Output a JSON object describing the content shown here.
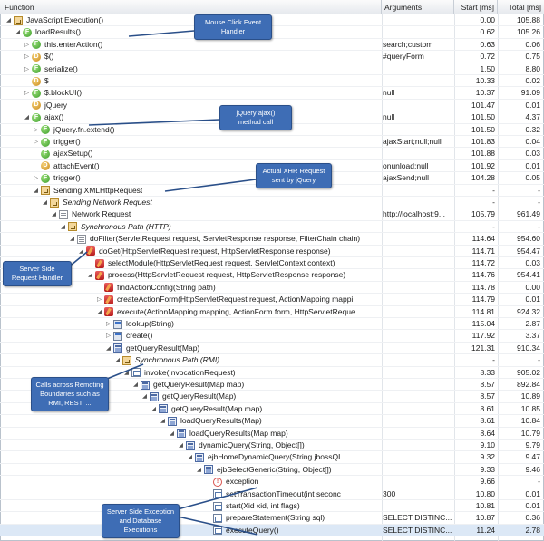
{
  "header": {
    "function_col": "Function",
    "arguments_col": "Arguments",
    "start_col": "Start [ms]",
    "total_col": "Total [ms]"
  },
  "rows": [
    {
      "d": 0,
      "tw": "◢",
      "ic": "r",
      "fn": "JavaScript Execution()",
      "args": "",
      "start": "0.00",
      "total": "105.88"
    },
    {
      "d": 1,
      "tw": "◢",
      "ic": "f",
      "fn": "loadResults()",
      "args": "",
      "start": "0.62",
      "total": "105.26"
    },
    {
      "d": 2,
      "tw": "▷",
      "ic": "f",
      "fn": "this.enterAction()",
      "args": "search;custom",
      "start": "0.63",
      "total": "0.06"
    },
    {
      "d": 2,
      "tw": "▷",
      "ic": "d",
      "fn": "$()",
      "args": "#queryForm",
      "start": "0.72",
      "total": "0.75"
    },
    {
      "d": 2,
      "tw": "▷",
      "ic": "f",
      "fn": "serialize()",
      "args": "",
      "start": "1.50",
      "total": "8.80"
    },
    {
      "d": 2,
      "tw": "",
      "ic": "d",
      "fn": "$",
      "args": "",
      "start": "10.33",
      "total": "0.02"
    },
    {
      "d": 2,
      "tw": "▷",
      "ic": "f",
      "fn": "$.blockUI()",
      "args": "null",
      "start": "10.37",
      "total": "91.09"
    },
    {
      "d": 2,
      "tw": "",
      "ic": "d",
      "fn": "jQuery",
      "args": "",
      "start": "101.47",
      "total": "0.01"
    },
    {
      "d": 2,
      "tw": "◢",
      "ic": "f",
      "fn": "ajax()",
      "args": "null",
      "start": "101.50",
      "total": "4.37"
    },
    {
      "d": 3,
      "tw": "▷",
      "ic": "f",
      "fn": "jQuery.fn.extend()",
      "args": "",
      "start": "101.50",
      "total": "0.32"
    },
    {
      "d": 3,
      "tw": "▷",
      "ic": "f",
      "fn": "trigger()",
      "args": "ajaxStart;null;null",
      "start": "101.83",
      "total": "0.04"
    },
    {
      "d": 3,
      "tw": "",
      "ic": "f",
      "fn": "ajaxSetup()",
      "args": "",
      "start": "101.88",
      "total": "0.03"
    },
    {
      "d": 3,
      "tw": "",
      "ic": "d",
      "fn": "attachEvent()",
      "args": "onunload;null",
      "start": "101.92",
      "total": "0.01"
    },
    {
      "d": 3,
      "tw": "▷",
      "ic": "f",
      "fn": "trigger()",
      "args": "ajaxSend;null",
      "start": "104.28",
      "total": "0.05"
    },
    {
      "d": 3,
      "tw": "◢",
      "ic": "r",
      "fn": "Sending XMLHttpRequest",
      "args": "",
      "start": "-",
      "total": "-"
    },
    {
      "d": 4,
      "tw": "◢",
      "ic": "r",
      "fn": "Sending Network Request",
      "it": true,
      "args": "",
      "start": "-",
      "total": "-"
    },
    {
      "d": 5,
      "tw": "◢",
      "ic": "p",
      "fn": "Network Request",
      "args": "http://localhost:9...",
      "start": "105.79",
      "total": "961.49"
    },
    {
      "d": 6,
      "tw": "◢",
      "ic": "r",
      "fn": "Synchronous Path (HTTP)",
      "it": true,
      "args": "",
      "start": "-",
      "total": "-"
    },
    {
      "d": 7,
      "tw": "◢",
      "ic": "p",
      "fn": "doFilter(ServletRequest request, ServletResponse response, FilterChain chain)",
      "args": "",
      "start": "114.64",
      "total": "954.60"
    },
    {
      "d": 8,
      "tw": "◢",
      "ic": "b",
      "fn": "doGet(HttpServletRequest request, HttpServletResponse response)",
      "args": "",
      "start": "114.71",
      "total": "954.47"
    },
    {
      "d": 9,
      "tw": "",
      "ic": "b",
      "fn": "selectModule(HttpServletRequest request, ServletContext context)",
      "args": "",
      "start": "114.72",
      "total": "0.03"
    },
    {
      "d": 9,
      "tw": "◢",
      "ic": "b",
      "fn": "process(HttpServletRequest request, HttpServletResponse response)",
      "args": "",
      "start": "114.76",
      "total": "954.41"
    },
    {
      "d": 10,
      "tw": "",
      "ic": "b",
      "fn": "findActionConfig(String path)",
      "args": "",
      "start": "114.78",
      "total": "0.00"
    },
    {
      "d": 10,
      "tw": "▷",
      "ic": "b",
      "fn": "createActionForm(HttpServletRequest request, ActionMapping mappi",
      "args": "",
      "start": "114.79",
      "total": "0.01"
    },
    {
      "d": 10,
      "tw": "◢",
      "ic": "b",
      "fn": "execute(ActionMapping mapping, ActionForm form, HttpServletReque",
      "args": "",
      "start": "114.81",
      "total": "924.32"
    },
    {
      "d": 11,
      "tw": "▷",
      "ic": "t",
      "fn": "lookup(String)",
      "args": "",
      "start": "115.04",
      "total": "2.87"
    },
    {
      "d": 11,
      "tw": "▷",
      "ic": "t",
      "fn": "create()",
      "args": "",
      "start": "117.92",
      "total": "3.37"
    },
    {
      "d": 11,
      "tw": "◢",
      "ic": "m",
      "fn": "getQueryResult(Map)",
      "args": "",
      "start": "121.31",
      "total": "910.34"
    },
    {
      "d": 12,
      "tw": "◢",
      "ic": "r",
      "fn": "Synchronous Path (RMI)",
      "it": true,
      "args": "",
      "start": "-",
      "total": "-"
    },
    {
      "d": 13,
      "tw": "◢",
      "ic": "x",
      "fn": "invoke(InvocationRequest)",
      "args": "",
      "start": "8.33",
      "total": "905.02"
    },
    {
      "d": 14,
      "tw": "◢",
      "ic": "m",
      "fn": "getQueryResult(Map map)",
      "args": "",
      "start": "8.57",
      "total": "892.84"
    },
    {
      "d": 15,
      "tw": "◢",
      "ic": "m",
      "fn": "getQueryResult(Map)",
      "args": "",
      "start": "8.57",
      "total": "10.89"
    },
    {
      "d": 16,
      "tw": "◢",
      "ic": "m",
      "fn": "getQueryResult(Map map)",
      "args": "",
      "start": "8.61",
      "total": "10.85"
    },
    {
      "d": 17,
      "tw": "◢",
      "ic": "m",
      "fn": "loadQueryResults(Map)",
      "args": "",
      "start": "8.61",
      "total": "10.84"
    },
    {
      "d": 18,
      "tw": "◢",
      "ic": "m",
      "fn": "loadQueryResults(Map map)",
      "args": "",
      "start": "8.64",
      "total": "10.79"
    },
    {
      "d": 19,
      "tw": "◢",
      "ic": "m",
      "fn": "dynamicQuery(String, Object[])",
      "args": "",
      "start": "9.10",
      "total": "9.79"
    },
    {
      "d": 20,
      "tw": "◢",
      "ic": "m",
      "fn": "ejbHomeDynamicQuery(String jbossQL",
      "args": "",
      "start": "9.32",
      "total": "9.47"
    },
    {
      "d": 21,
      "tw": "◢",
      "ic": "m",
      "fn": "ejbSelectGeneric(String, Object[])",
      "args": "",
      "start": "9.33",
      "total": "9.46"
    },
    {
      "d": 22,
      "tw": "",
      "ic": "s",
      "fn": "exception",
      "args": "",
      "start": "9.66",
      "total": "-"
    },
    {
      "d": 22,
      "tw": "",
      "ic": "x",
      "fn": "setTransactionTimeout(int seconc",
      "args": "300",
      "start": "10.80",
      "total": "0.01"
    },
    {
      "d": 22,
      "tw": "",
      "ic": "x",
      "fn": "start(Xid xid, int flags)",
      "args": "",
      "start": "10.81",
      "total": "0.01"
    },
    {
      "d": 22,
      "tw": "",
      "ic": "x",
      "fn": "prepareStatement(String sql)",
      "args": "SELECT DISTINC...",
      "start": "10.87",
      "total": "0.36"
    },
    {
      "d": 22,
      "tw": "",
      "ic": "x",
      "fn": "executeQuery()",
      "args": "SELECT DISTINC...",
      "start": "11.24",
      "total": "2.78",
      "sel": true
    }
  ],
  "callouts": {
    "mouse_click": "Mouse Click Event Handler",
    "jquery_ajax": "jQuery ajax() method call",
    "xhr": "Actual XHR Request sent by jQuery",
    "server_side": "Server Side Request Handler",
    "remoting": "Calls across Remoting Boundaries such as RMI, REST, ...",
    "exception": "Server Side Exception and Database Executions"
  },
  "colors": {
    "callout_bg": "#3e6db5",
    "selection": "#dce8f6",
    "header_bg": "#e6e9ee"
  }
}
